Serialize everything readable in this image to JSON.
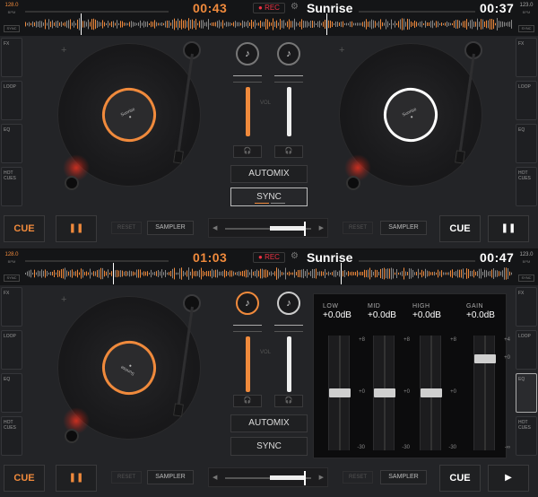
{
  "screens": [
    {
      "header": {
        "bpm_left": "128.0",
        "bpm_left_unit": "BPM",
        "btn_left": "SYNC",
        "time_left": "00:43",
        "rec_label": "● REC",
        "track_title": "Sunrise",
        "time_right": "00:37",
        "bpm_right": "123.0",
        "bpm_right_unit": "BPM",
        "btn_right": "SYNC"
      },
      "side_left": [
        "FX",
        "LOOP",
        "EQ",
        "HOT CUES"
      ],
      "side_right": [
        "FX",
        "LOOP",
        "EQ",
        "HOT CUES"
      ],
      "mixer": {
        "vol_label": "VOL",
        "automix_label": "AUTOMIX",
        "sync_label": "SYNC"
      },
      "labels": {
        "cue": "CUE",
        "reset": "RESET",
        "sampler": "SAMPLER"
      }
    },
    {
      "header": {
        "bpm_left": "128.0",
        "bpm_left_unit": "BPM",
        "btn_left": "SYNC",
        "time_left": "01:03",
        "rec_label": "● REC",
        "track_title": "Sunrise",
        "time_right": "00:47",
        "bpm_right": "123.0",
        "bpm_right_unit": "BPM",
        "btn_right": "SYNC"
      },
      "side_left": [
        "FX",
        "LOOP",
        "EQ",
        "HOT CUES"
      ],
      "side_right": [
        "FX",
        "LOOP",
        "EQ",
        "HOT CUES"
      ],
      "mixer": {
        "vol_label": "VOL",
        "automix_label": "AUTOMIX",
        "sync_label": "SYNC"
      },
      "labels": {
        "cue": "CUE",
        "reset": "RESET",
        "sampler": "SAMPLER"
      },
      "eq": {
        "bands": [
          {
            "name": "LOW",
            "value": "+0.0dB",
            "top": "+8",
            "mid": "+0",
            "bottom": "-30",
            "level": 0.5
          },
          {
            "name": "MID",
            "value": "+0.0dB",
            "top": "+8",
            "mid": "+0",
            "bottom": "-30",
            "level": 0.5
          },
          {
            "name": "HIGH",
            "value": "+0.0dB",
            "top": "+8",
            "mid": "+0",
            "bottom": "-30",
            "level": 0.5
          },
          {
            "name": "GAIN",
            "value": "+0.0dB",
            "top": "+4",
            "mid": "+0",
            "bottom": "-∞",
            "level": 0.82
          }
        ]
      }
    }
  ],
  "colors": {
    "accent": "#f08a3c",
    "white": "#ffffff",
    "rec": "#ee3344"
  },
  "icons": {
    "music": "music-note-icon",
    "headphones": "headphones-icon",
    "pause": "pause-icon",
    "play": "play-icon",
    "gear": "gear-icon"
  }
}
